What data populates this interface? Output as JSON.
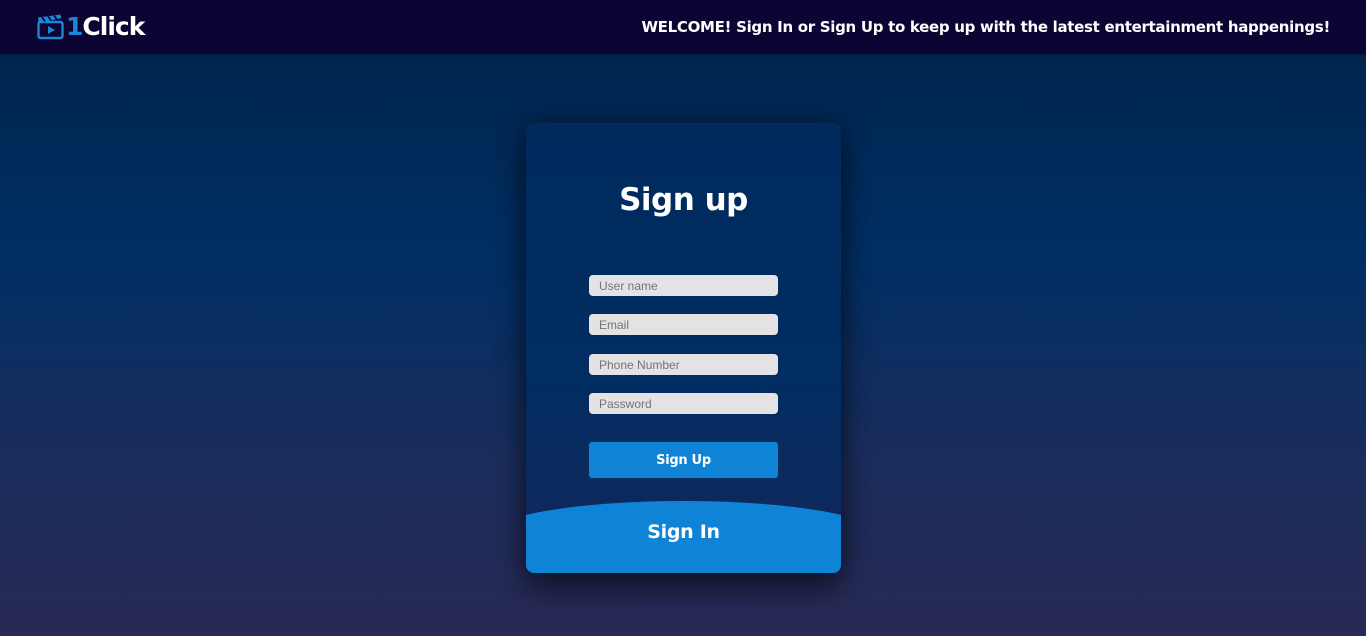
{
  "header": {
    "logo_text": "Click",
    "logo_number": "1",
    "welcome": "WELCOME! Sign In or Sign Up to keep up with the latest entertainment happenings!"
  },
  "form": {
    "title": "Sign up",
    "username_placeholder": "User name",
    "email_placeholder": "Email",
    "phone_placeholder": "Phone Number",
    "password_placeholder": "Password",
    "signup_label": "Sign Up",
    "signin_label": "Sign In"
  },
  "colors": {
    "topbar": "#0c0433",
    "accent": "#0f83d6",
    "card": "#002a5c",
    "input": "#e4e2e4"
  },
  "icons": {
    "logo": "clapperboard-play-icon"
  }
}
